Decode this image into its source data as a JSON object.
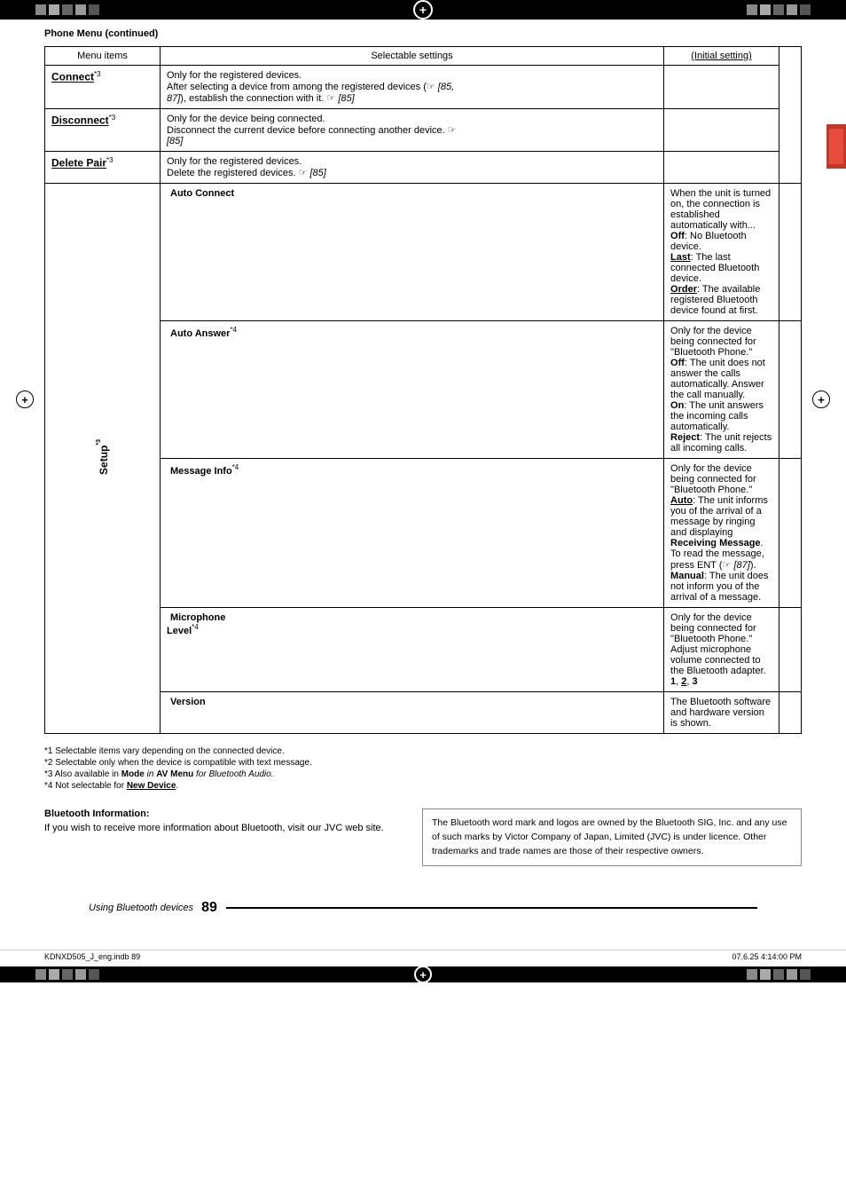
{
  "page": {
    "top_section": "Phone Menu (continued)",
    "table": {
      "headers": {
        "col1": "Menu items",
        "col2": "Selectable settings",
        "col3": "(Initial setting)"
      },
      "rows": [
        {
          "id": "connect",
          "menu": "Connect",
          "superscript": "*3",
          "type": "main",
          "settings": "Only for the registered devices.\nAfter selecting a device from among the registered devices (☞ [85, 87]), establish the connection with it. ☞ [85]",
          "initial": ""
        },
        {
          "id": "disconnect",
          "menu": "Disconnect",
          "superscript": "*3",
          "type": "main",
          "settings": "Only for the device being connected.\nDisconnect the current device before connecting another device. ☞ [85]",
          "initial": ""
        },
        {
          "id": "delete-pair",
          "menu": "Delete Pair",
          "superscript": "*3",
          "type": "main",
          "settings": "Only for the registered devices.\nDelete the registered devices. ☞ [85]",
          "initial": ""
        },
        {
          "id": "setup",
          "type": "setup-group",
          "setup_label": "Setup",
          "setup_superscript": "*3",
          "sub_rows": [
            {
              "id": "auto-connect",
              "menu": "Auto Connect",
              "settings_lines": [
                "When the unit is turned on, the connection is established automatically with...",
                "Off: No Bluetooth device.",
                "Last: The last connected Bluetooth device.",
                "Order: The available registered Bluetooth device found at first."
              ],
              "initial": ""
            },
            {
              "id": "auto-answer",
              "menu": "Auto Answer",
              "superscript": "*4",
              "settings_lines": [
                "Only for the device being connected for \"Bluetooth Phone.\"",
                "Off: The unit does not answer the calls automatically. Answer the call manually.",
                "On: The unit answers the incoming calls automatically.",
                "Reject: The unit rejects all incoming calls."
              ],
              "initial": ""
            },
            {
              "id": "message-info",
              "menu": "Message Info",
              "superscript": "*4",
              "settings_lines": [
                "Only for the device being connected for \"Bluetooth Phone.\"",
                "Auto: The unit informs you of the arrival of a message by ringing and displaying Receiving Message. To read the message, press ENT (☞ [87]).",
                "Manual: The unit does not inform you of the arrival of a message."
              ],
              "initial": ""
            },
            {
              "id": "microphone-level",
              "menu": "Microphone Level",
              "superscript": "*4",
              "settings_lines": [
                "Only for the device being connected for \"Bluetooth Phone.\"",
                "Adjust microphone volume connected to the Bluetooth adapter.",
                "1, 2, 3"
              ],
              "initial": ""
            },
            {
              "id": "version",
              "menu": "Version",
              "settings_lines": [
                "The Bluetooth software and hardware version is shown."
              ],
              "initial": ""
            }
          ]
        }
      ]
    },
    "footnotes": [
      "*1 Selectable items vary depending on the connected device.",
      "*2 Selectable only when the device is compatible with text message.",
      "*3 Also available in Mode in AV Menu for Bluetooth Audio.",
      "*4 Not selectable for New Device."
    ],
    "bluetooth_section": {
      "title": "Bluetooth Information:",
      "left_text": "If you wish to receive more information about Bluetooth, visit our JVC web site.",
      "right_text": "The Bluetooth word mark and logos are owned by the Bluetooth SIG, Inc. and any use of such marks by Victor Company of Japan, Limited (JVC) is under licence. Other trademarks and trade names are those of their respective owners."
    },
    "bottom_nav": {
      "label": "Using Bluetooth devices",
      "page_number": "89"
    },
    "bottom_footer": {
      "left": "KDNXD505_J_eng.indb  89",
      "right": "07.6.25  4:14:00 PM"
    }
  }
}
